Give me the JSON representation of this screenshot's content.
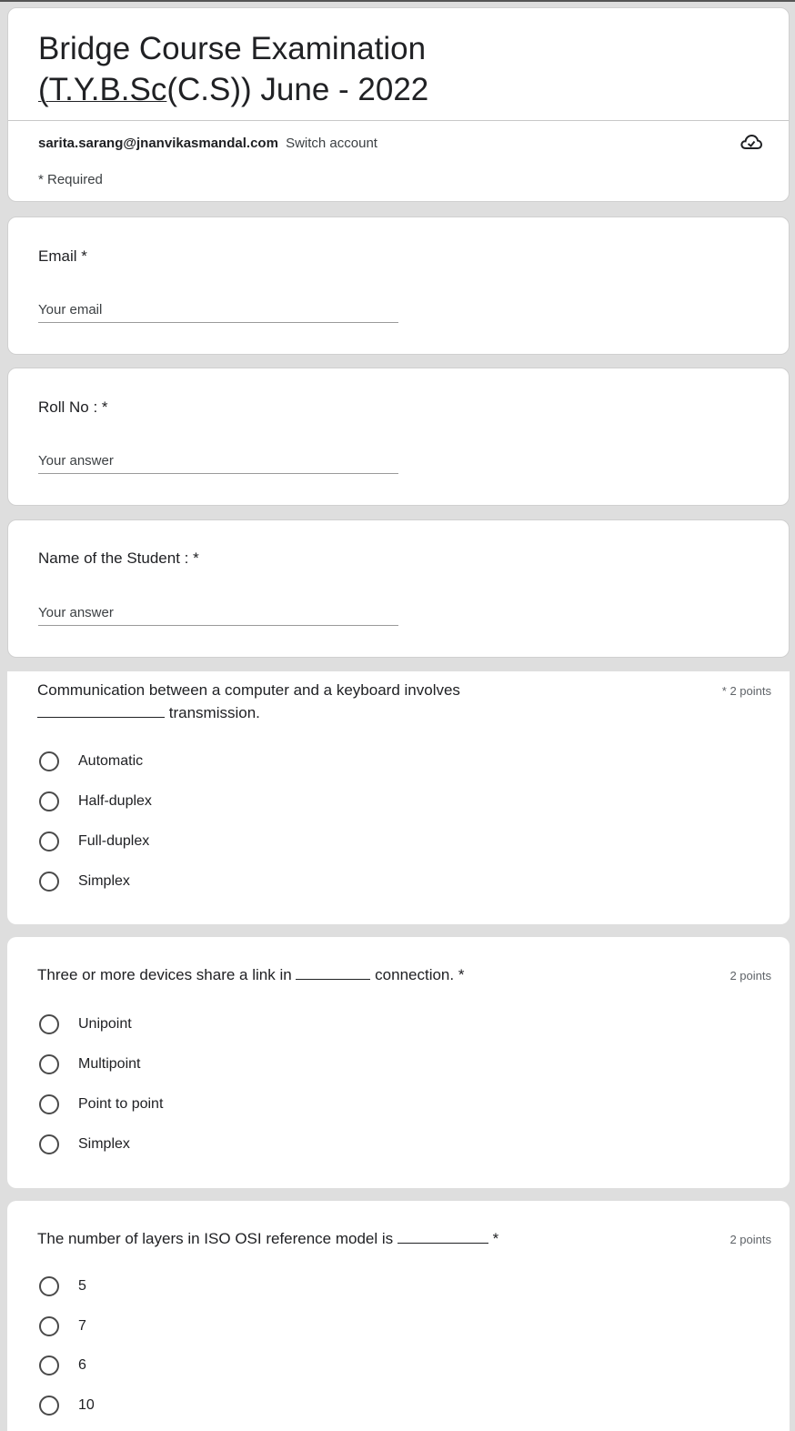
{
  "form": {
    "title_line1": "Bridge Course Examination",
    "title_part_underlined": "T.Y.B.Sc",
    "title_part_rest": "(C.S)) June - 2022",
    "title_open_paren": "("
  },
  "account": {
    "email": "sarita.sarang@jnanvikasmandal.com",
    "switch_label": "Switch account",
    "cloud_icon": "cloud-saved-icon"
  },
  "required_note": "* Required",
  "fields": {
    "email": {
      "label": "Email *",
      "placeholder": "Your email"
    },
    "roll": {
      "label": "Roll No : *",
      "placeholder": "Your answer"
    },
    "name": {
      "label": "Name of the Student : *",
      "placeholder": "Your answer"
    }
  },
  "questions": [
    {
      "text_part1": "Communication between a computer and a keyboard involves",
      "text_part2": "transmission.",
      "required_marker": "*",
      "points": "2 points",
      "options": [
        "Automatic",
        "Half-duplex",
        "Full-duplex",
        "Simplex"
      ]
    },
    {
      "text_part1": "Three or more devices share a link in",
      "text_part2": "connection. *",
      "points": "2 points",
      "options": [
        "Unipoint",
        "Multipoint",
        "Point to point",
        "Simplex"
      ]
    },
    {
      "text_part1": "The number of layers in ISO OSI reference model is",
      "text_part2": "*",
      "points": "2 points",
      "options": [
        "5",
        "7",
        "6",
        "10"
      ]
    }
  ]
}
